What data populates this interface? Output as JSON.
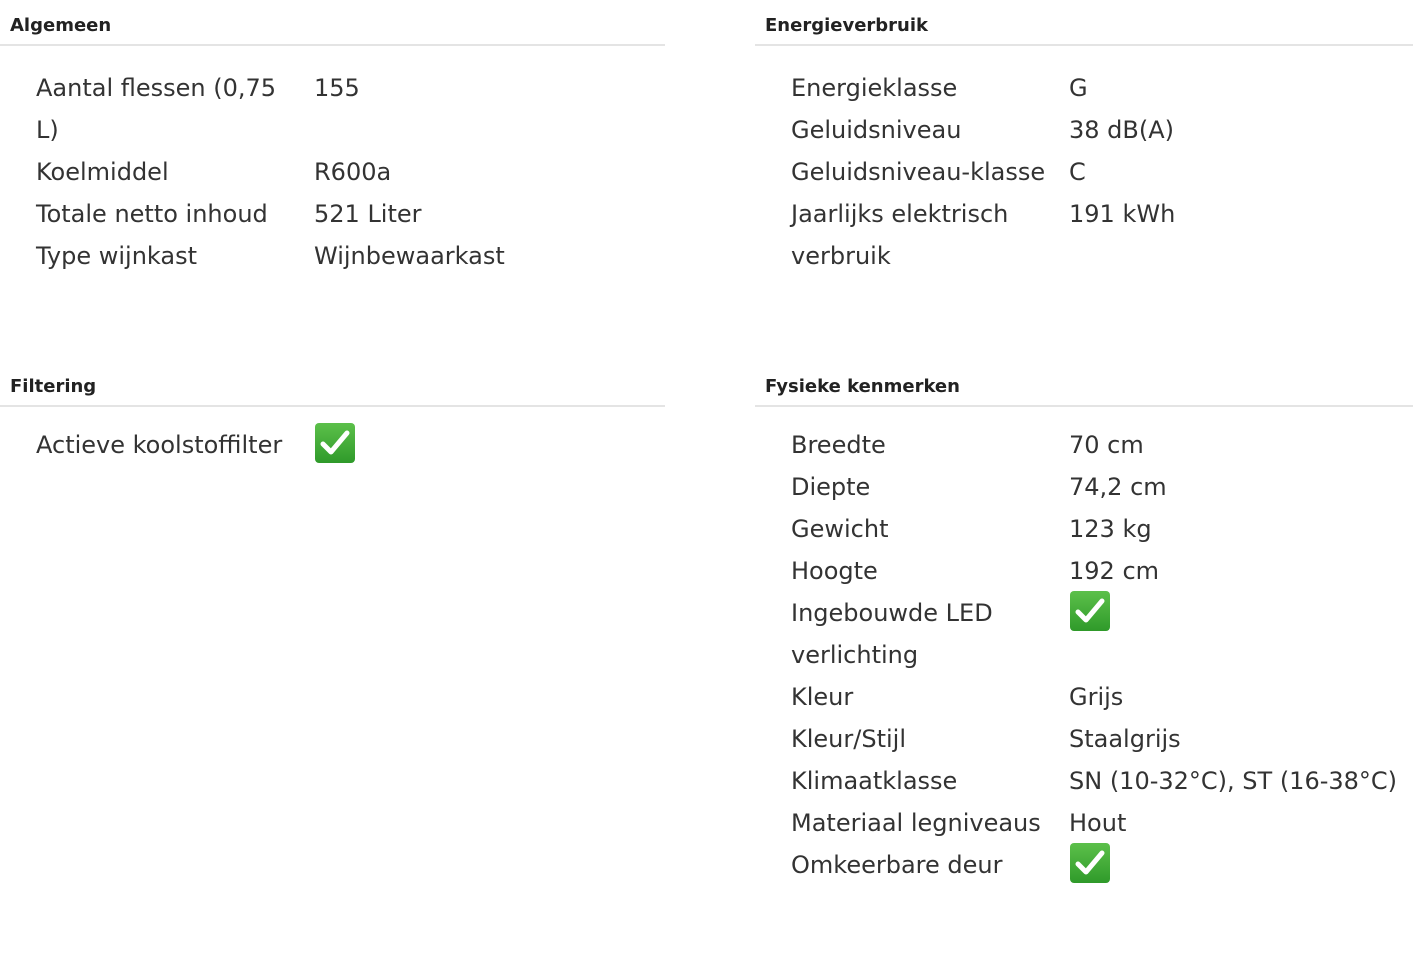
{
  "sections": {
    "algemeen": {
      "title": "Algemeen",
      "rows": [
        {
          "label": "Aantal flessen (0,75 L)",
          "value": "155"
        },
        {
          "label": "Koelmiddel",
          "value": "R600a"
        },
        {
          "label": "Totale netto inhoud",
          "value": "521 Liter"
        },
        {
          "label": "Type wijnkast",
          "value": "Wijnbewaarkast"
        }
      ]
    },
    "energieverbruik": {
      "title": "Energieverbruik",
      "rows": [
        {
          "label": "Energieklasse",
          "value": "G"
        },
        {
          "label": "Geluidsniveau",
          "value": "38 dB(A)"
        },
        {
          "label": "Geluidsniveau-klasse",
          "value": "C"
        },
        {
          "label": "Jaarlijks elektrisch verbruik",
          "value": "191 kWh"
        }
      ]
    },
    "filtering": {
      "title": "Filtering",
      "rows": [
        {
          "label": "Actieve koolstoffilter",
          "icon": "check-icon"
        }
      ]
    },
    "fysieke_kenmerken": {
      "title": "Fysieke kenmerken",
      "rows": [
        {
          "label": "Breedte",
          "value": "70 cm"
        },
        {
          "label": "Diepte",
          "value": "74,2 cm"
        },
        {
          "label": "Gewicht",
          "value": "123 kg"
        },
        {
          "label": "Hoogte",
          "value": "192 cm"
        },
        {
          "label": "Ingebouwde LED verlichting",
          "icon": "check-icon"
        },
        {
          "label": "Kleur",
          "value": "Grijs"
        },
        {
          "label": "Kleur/Stijl",
          "value": "Staalgrijs"
        },
        {
          "label": "Klimaatklasse",
          "value": "SN (10-32°C), ST (16-38°C)"
        },
        {
          "label": "Materiaal legniveaus",
          "value": "Hout"
        },
        {
          "label": "Omkeerbare deur",
          "icon": "check-icon"
        }
      ]
    }
  },
  "colors": {
    "check_green": "#3fa535",
    "divider": "#e4e4e4",
    "text": "#333333"
  }
}
